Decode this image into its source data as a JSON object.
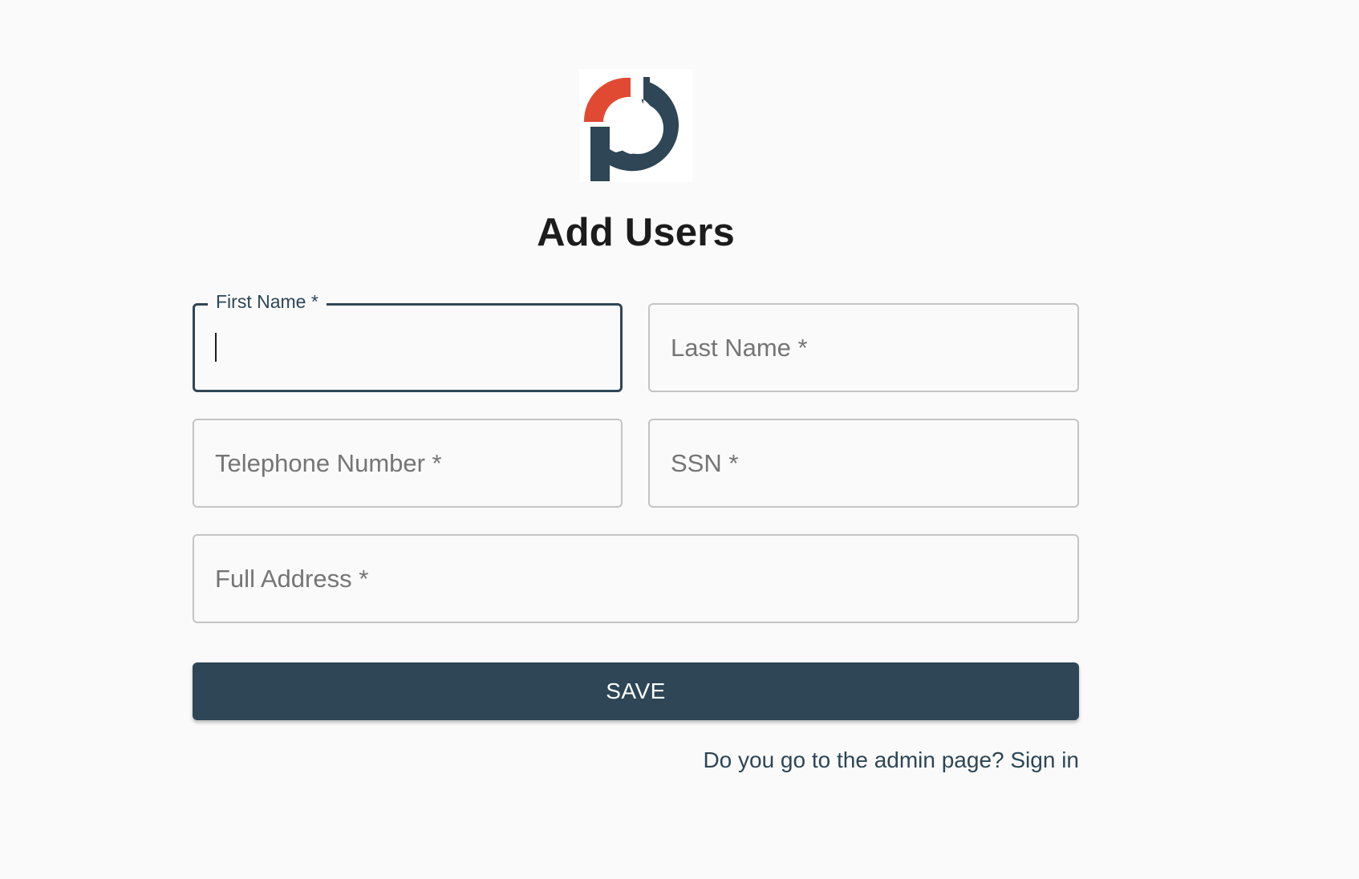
{
  "page": {
    "title": "Add Users",
    "logo_icon": "brand-logo"
  },
  "colors": {
    "primary": "#2e4656",
    "accent": "#e04a32",
    "background": "#fafafa",
    "border": "#c4c4c4",
    "placeholder": "#757575"
  },
  "form": {
    "first_name": {
      "label": "First Name *",
      "value": "",
      "focused": true
    },
    "last_name": {
      "placeholder": "Last Name *"
    },
    "telephone": {
      "placeholder": "Telephone Number *"
    },
    "ssn": {
      "placeholder": "SSN *"
    },
    "address": {
      "placeholder": "Full Address *"
    }
  },
  "actions": {
    "save_label": "SAVE"
  },
  "footer": {
    "admin_link": "Do you go to the admin page? Sign in"
  }
}
